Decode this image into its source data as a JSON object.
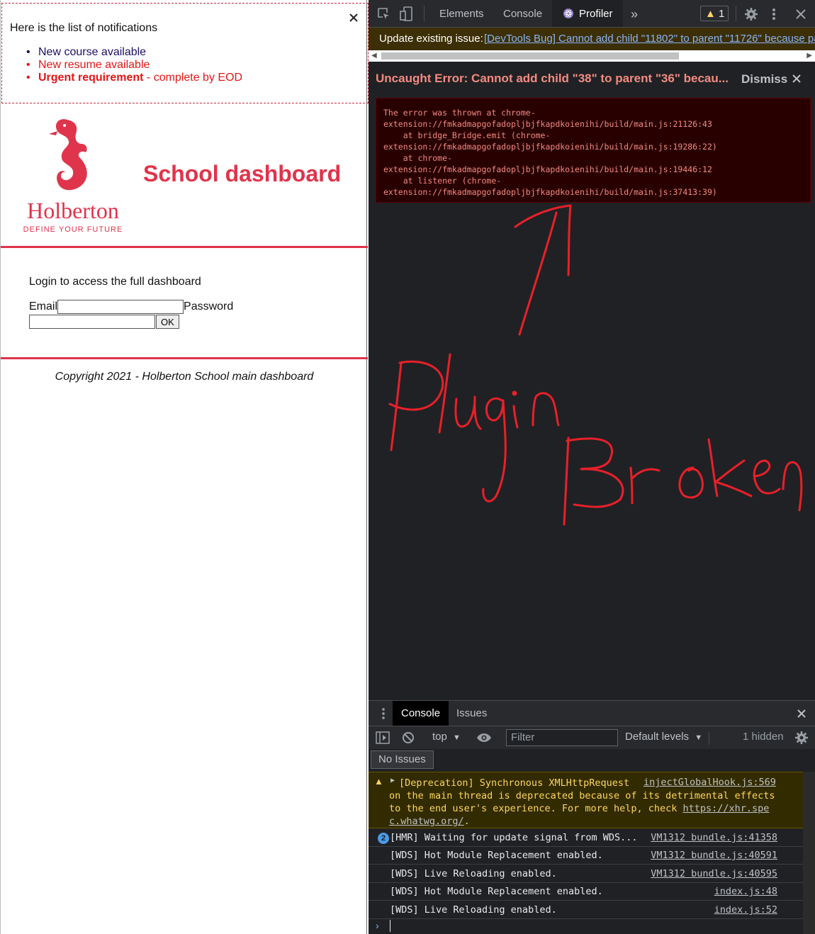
{
  "notifications": {
    "title": "Here is the list of notifications",
    "items": [
      {
        "text": "New course available",
        "type": "default"
      },
      {
        "text": "New resume available",
        "type": "urgent"
      }
    ],
    "urgent_html_bold": "Urgent requirement",
    "urgent_html_rest": " - complete by EOD"
  },
  "header": {
    "logo_text": "Holberton",
    "logo_tagline": "DEFINE YOUR FUTURE",
    "title": "School dashboard",
    "brand_color": "#df344b"
  },
  "login": {
    "prompt": "Login to access the full dashboard",
    "email_label": "Email",
    "password_label": "Password",
    "ok_label": "OK"
  },
  "footer": {
    "text": "Copyright 2021 - Holberton School main dashboard"
  },
  "devtools": {
    "tabs": [
      "Elements",
      "Console",
      "Profiler"
    ],
    "active_tab": "Profiler",
    "warning_count": "1",
    "issue_label": "Update existing issue:",
    "issue_link": "[DevTools Bug] Cannot add child \"11802\" to parent \"11726\" because pa",
    "error_title": "Uncaught Error: Cannot add child \"38\" to parent \"36\" becau...",
    "dismiss_label": "Dismiss",
    "error_stack": "The error was thrown at chrome-\nextension://fmkadmapgofadopljbjfkapdkoienihi/build/main.js:21126:43\n    at bridge_Bridge.emit (chrome-\nextension://fmkadmapgofadopljbjfkapdkoienihi/build/main.js:19286:22)\n    at chrome-\nextension://fmkadmapgofadopljbjfkapdkoienihi/build/main.js:19446:12\n    at listener (chrome-\nextension://fmkadmapgofadopljbjfkapdkoienihi/build/main.js:37413:39)",
    "annotation": "Plugin Broken",
    "drawer": {
      "tabs": [
        "Console",
        "Issues"
      ],
      "context": "top",
      "filter_placeholder": "Filter",
      "levels": "Default levels",
      "hidden": "1 hidden",
      "no_issues": "No Issues"
    },
    "console": {
      "warning": {
        "text": "[Deprecation] Synchronous XMLHttpRequest",
        "source": "injectGlobalHook.js:569",
        "rest": "on the main thread is deprecated because of its detrimental effects\nto the end user's experience. For more help, check ",
        "link": "https://xhr.spe\nc.whatwg.org/",
        "end": "."
      },
      "lines": [
        {
          "count": "2",
          "msg": "[HMR] Waiting for update signal from WDS...",
          "src": "VM1312 bundle.js:41358"
        },
        {
          "msg": "[WDS] Hot Module Replacement enabled.",
          "src": "VM1312 bundle.js:40591"
        },
        {
          "msg": "[WDS] Live Reloading enabled.",
          "src": "VM1312 bundle.js:40595"
        },
        {
          "msg": "[WDS] Hot Module Replacement enabled.",
          "src": "index.js:48"
        },
        {
          "msg": "[WDS] Live Reloading enabled.",
          "src": "index.js:52"
        }
      ]
    },
    "colors": {
      "bg": "#202124",
      "error": "#f28b82",
      "warning": "#fdd663",
      "link": "#8ab4f8",
      "annotation": "#e8202a"
    }
  }
}
